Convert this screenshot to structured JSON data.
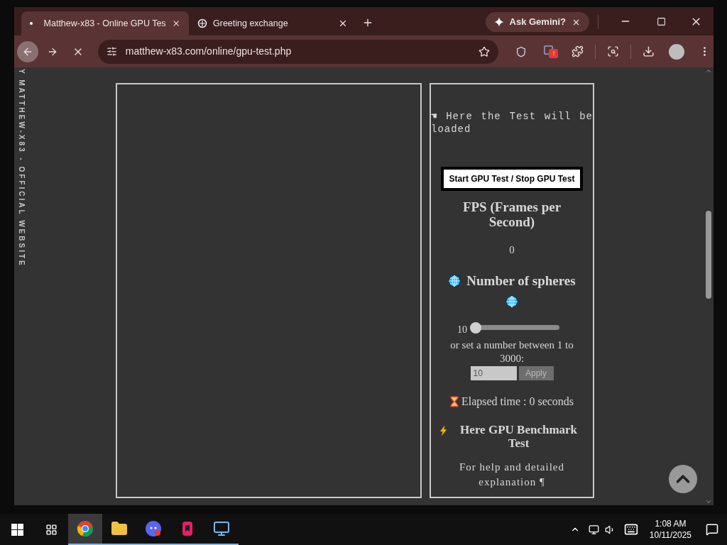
{
  "browser": {
    "tabs": [
      {
        "title": "Matthew-x83 - Online GPU Tes",
        "selected": true
      },
      {
        "title": "Greeting exchange",
        "selected": false
      }
    ],
    "gemini": "Ask Gemini?",
    "url": "matthew-x83.com/online/gpu-test.php",
    "extension_badge": "!"
  },
  "page": {
    "side_text": "Y MATTHEW-X83 - OFFICIAL WEBSITE",
    "loading_text": "☚ Here the Test will be loaded",
    "start_button": "Start GPU Test / Stop GPU Test",
    "fps_title": "FPS (Frames per Second)",
    "fps_value": "0",
    "spheres_title": "Number of spheres",
    "slider": {
      "reading": "10",
      "level": 0.003
    },
    "range_hint": "or set a number between 1 to 3000:",
    "count_field": {
      "value": "10"
    },
    "apply_button": {
      "label": "Apply",
      "disabled": true
    },
    "elapsed": "Elapsed time : 0 seconds",
    "benchmark_title": "Here GPU Benchmark Test",
    "help_text": "For help and detailed explanation ¶"
  },
  "taskbar": {
    "apps": [
      {
        "kind": "chrome",
        "selected": true
      },
      {
        "kind": "folder",
        "selected": false
      },
      {
        "kind": "chat",
        "selected": false
      },
      {
        "kind": "bookmark",
        "selected": false
      },
      {
        "kind": "remote",
        "selected": false
      }
    ],
    "time": "1:08 AM",
    "date": "10/11/2025"
  }
}
